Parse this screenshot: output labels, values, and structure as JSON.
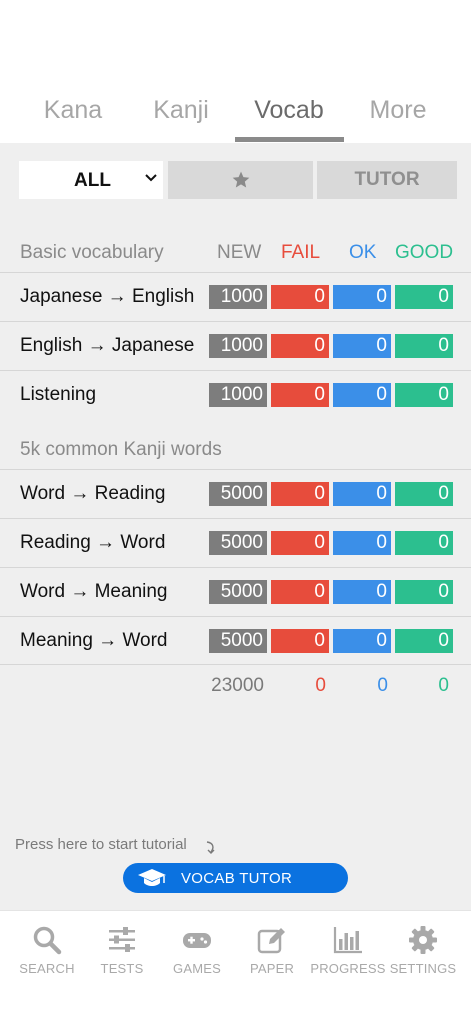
{
  "tabs": [
    {
      "label": "Kana",
      "active": false
    },
    {
      "label": "Kanji",
      "active": false
    },
    {
      "label": "Vocab",
      "active": true
    },
    {
      "label": "More",
      "active": false
    }
  ],
  "filter": {
    "select_value": "ALL",
    "tutor_label": "TUTOR"
  },
  "columns": {
    "new": "NEW",
    "fail": "FAIL",
    "ok": "OK",
    "good": "GOOD"
  },
  "sections": [
    {
      "title": "Basic vocabulary",
      "rows": [
        {
          "label": "Japanese → English",
          "new": "1000",
          "fail": "0",
          "ok": "0",
          "good": "0"
        },
        {
          "label": "English → Japanese",
          "new": "1000",
          "fail": "0",
          "ok": "0",
          "good": "0"
        },
        {
          "label": "Listening",
          "new": "1000",
          "fail": "0",
          "ok": "0",
          "good": "0"
        }
      ]
    },
    {
      "title": "5k common Kanji words",
      "rows": [
        {
          "label": "Word → Reading",
          "new": "5000",
          "fail": "0",
          "ok": "0",
          "good": "0"
        },
        {
          "label": "Reading → Word",
          "new": "5000",
          "fail": "0",
          "ok": "0",
          "good": "0"
        },
        {
          "label": "Word → Meaning",
          "new": "5000",
          "fail": "0",
          "ok": "0",
          "good": "0"
        },
        {
          "label": "Meaning → Word",
          "new": "5000",
          "fail": "0",
          "ok": "0",
          "good": "0"
        }
      ]
    }
  ],
  "totals": {
    "new": "23000",
    "fail": "0",
    "ok": "0",
    "good": "0"
  },
  "tutorial": {
    "hint": "Press here to start tutorial",
    "button_label": "VOCAB TUTOR"
  },
  "nav": [
    {
      "label": "SEARCH",
      "icon": "search-icon"
    },
    {
      "label": "TESTS",
      "icon": "sliders-icon"
    },
    {
      "label": "GAMES",
      "icon": "gamepad-icon"
    },
    {
      "label": "PAPER",
      "icon": "pencil-square-icon"
    },
    {
      "label": "PROGRESS",
      "icon": "bar-chart-icon"
    },
    {
      "label": "SETTINGS",
      "icon": "gear-icon"
    }
  ],
  "colors": {
    "new": "#7d7d7d",
    "fail": "#e74c3c",
    "ok": "#3b8fe8",
    "good": "#2cbf8f",
    "accent": "#0b72e0"
  }
}
